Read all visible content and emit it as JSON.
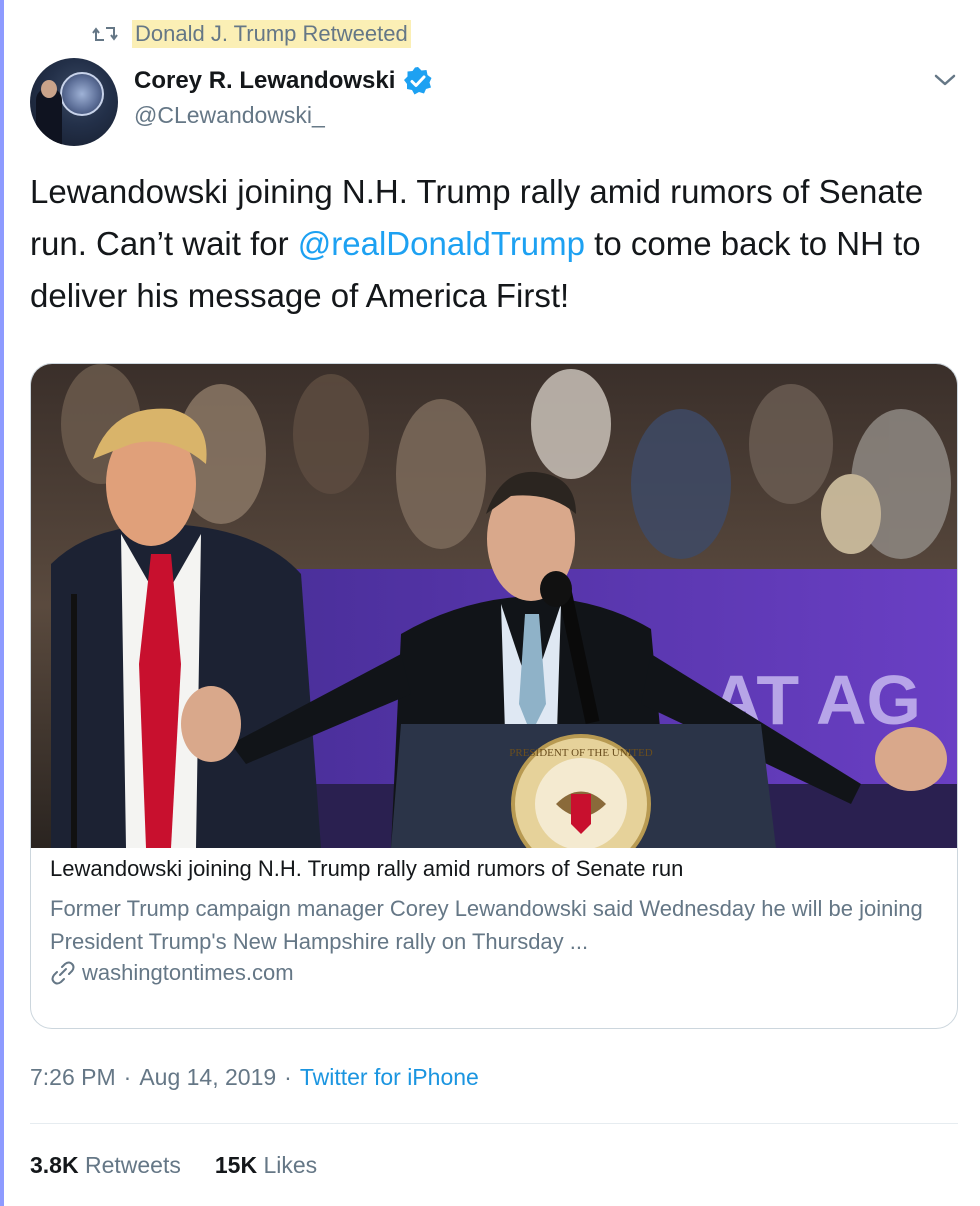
{
  "retweet_banner": {
    "text": "Donald J. Trump Retweeted",
    "icon": "retweet-icon"
  },
  "author": {
    "display_name": "Corey R. Lewandowski",
    "handle": "@CLewandowski_",
    "verified": true,
    "avatar_icon": "avatar"
  },
  "tweet": {
    "text_before": "Lewandowski joining N.H. Trump rally amid rumors of Senate run. Can’t wait for ",
    "mention": "@realDonaldTrump",
    "text_after": " to come back to NH to deliver his message of America First!"
  },
  "card": {
    "title": "Lewandowski joining N.H. Trump rally amid rumors of Senate run",
    "description": "Former Trump campaign manager Corey Lewandowski said Wednesday he will be joining President Trump's New Hampshire rally on Thursday ...",
    "domain": "washingtontimes.com",
    "image_alt": "Corey Lewandowski speaking at a podium at a rally with Donald Trump standing behind him",
    "banner_text": "AT AG",
    "seal_text": "PRESIDENT OF THE UNITED"
  },
  "meta": {
    "time": "7:26 PM",
    "separator": "·",
    "date": "Aug 14, 2019",
    "source": "Twitter for iPhone"
  },
  "stats": {
    "retweets_count": "3.8K",
    "retweets_label": "Retweets",
    "likes_count": "15K",
    "likes_label": "Likes"
  },
  "colors": {
    "link_blue": "#1da1f2",
    "muted_gray": "#657786",
    "highlight": "#fbefb5",
    "verified_blue": "#1da1f2"
  }
}
